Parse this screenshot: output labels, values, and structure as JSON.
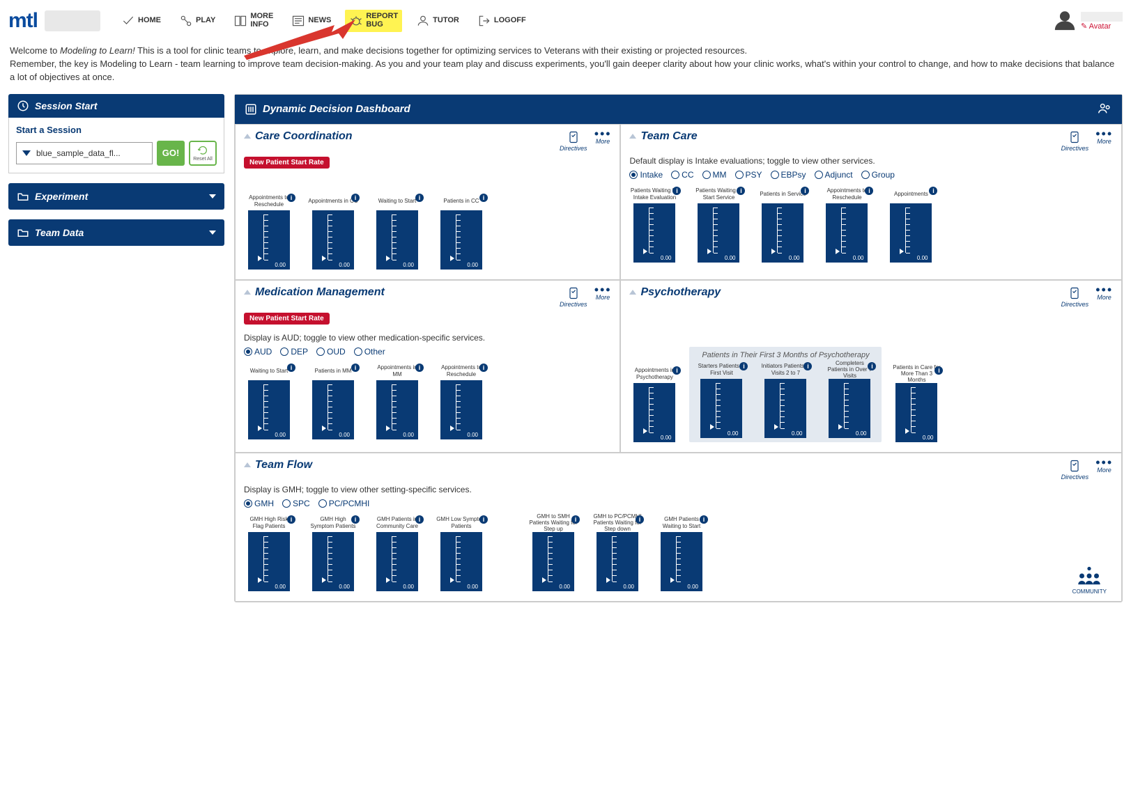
{
  "nav": {
    "home": "HOME",
    "play": "PLAY",
    "more_info1": "MORE",
    "more_info2": "INFO",
    "news": "NEWS",
    "report1": "REPORT",
    "report2": "BUG",
    "tutor": "TUTOR",
    "logoff": "LOGOFF"
  },
  "avatar_link": "✎ Avatar",
  "intro": {
    "welcome_prefix": "Welcome to ",
    "welcome_em": "Modeling to Learn!",
    "p1_rest": " This is a tool for clinic teams to explore, learn, and make decisions together for optimizing services to Veterans with their existing or projected resources.",
    "p2": "Remember, the key is Modeling to Learn - team learning to improve team decision-making. As you and your team play and discuss experiments, you'll gain deeper clarity about how your clinic works, what's within your control to change, and how to make decisions that balance a lot of objectives at once."
  },
  "left": {
    "session_start": "Session Start",
    "start_a_session": "Start a Session",
    "dd_value": "blue_sample_data_fl...",
    "go": "GO!",
    "reset": "Reset All",
    "experiment": "Experiment",
    "team_data": "Team Data"
  },
  "main_title": "Dynamic Decision Dashboard",
  "directives": "Directives",
  "more": "More",
  "sections": {
    "cc": {
      "title": "Care Coordination",
      "badge": "New Patient Start Rate",
      "gauges": [
        "Appointments\nto Reschedule",
        "Appointments\nin CC",
        "Waiting to Start",
        "Patients in CC"
      ]
    },
    "tc": {
      "title": "Team Care",
      "sub": "Default display is Intake evaluations; toggle to view other services.",
      "radios": [
        "Intake",
        "CC",
        "MM",
        "PSY",
        "EBPsy",
        "Adjunct",
        "Group"
      ],
      "gauges": [
        "Patients Waiting for\nIntake Evaluation",
        "Patients Waiting\nto Start Service",
        "Patients\nin Service",
        "Appointments\nto Reschedule",
        "Appointments"
      ]
    },
    "mm": {
      "title": "Medication Management",
      "badge": "New Patient Start Rate",
      "sub": "Display is AUD; toggle to view other medication-specific services.",
      "radios": [
        "AUD",
        "DEP",
        "OUD",
        "Other"
      ],
      "gauges": [
        "Waiting to Start",
        "Patients in MM",
        "Appointments\nin MM",
        "Appointments\nto Reschedule"
      ]
    },
    "psy": {
      "title": "Psychotherapy",
      "group_title": "Patients in Their First 3 Months of Psychotherapy",
      "gauges_left": [
        "Appointments in\nPsychotherapy"
      ],
      "gauges_group": [
        "Starters\nPatients in\nFirst Visit",
        "Initiators\nPatients in Visits\n2 to 7",
        "Completers\nPatients in Over\n7 Visits"
      ],
      "gauges_right": [
        "Patients in Care\nfor More Than\n3 Months"
      ]
    },
    "tf": {
      "title": "Team Flow",
      "sub": "Display is GMH; toggle to view other setting-specific services.",
      "radios": [
        "GMH",
        "SPC",
        "PC/PCMHI"
      ],
      "gauges_a": [
        "GMH\nHigh Risk\nFlag Patients",
        "GMH\nHigh Symptom\nPatients",
        "GMH Patients in\nCommunity Care",
        "GMH Low\nSymptom Patients"
      ],
      "gauges_b": [
        "GMH to SMH\nPatients Waiting\nfor Step up",
        "GMH to PC/PCMHI\nPatients Waiting\nfor Step down",
        "GMH Patients\nWaiting to Start"
      ]
    }
  },
  "gauge_value": "0.00",
  "community": "COMMUNITY"
}
